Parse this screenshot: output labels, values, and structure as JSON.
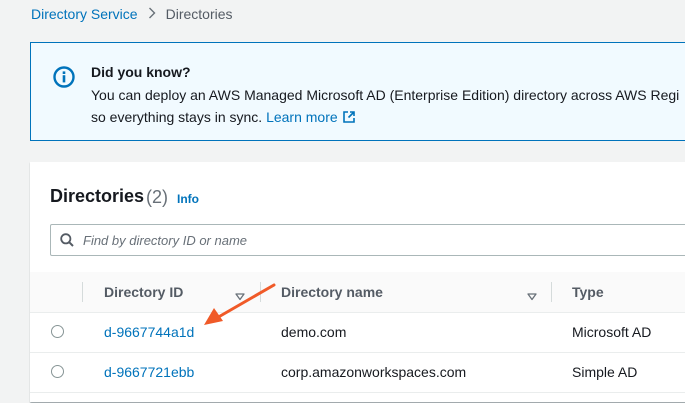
{
  "breadcrumb": {
    "service": "Directory Service",
    "separator": ">",
    "current": "Directories"
  },
  "alert": {
    "icon": "info-circle-icon",
    "title": "Did you know?",
    "line1": "You can deploy an AWS Managed Microsoft AD (Enterprise Edition) directory across AWS Regi",
    "line2": "so everything stays in sync.",
    "link": "Learn more",
    "link_icon": "external-link-icon"
  },
  "panel": {
    "title": "Directories",
    "count": "(2)",
    "info_label": "Info"
  },
  "search": {
    "placeholder": "Find by directory ID or name",
    "value": ""
  },
  "table": {
    "columns": [
      "Directory ID",
      "Directory name",
      "Type"
    ],
    "rows": [
      {
        "id": "d-9667744a1d",
        "name": "demo.com",
        "type": "Microsoft AD"
      },
      {
        "id": "d-9667721ebb",
        "name": "corp.amazonworkspaces.com",
        "type": "Simple AD"
      }
    ]
  },
  "colors": {
    "link": "#0073bb",
    "alert_bg": "#f1faff",
    "annotation_arrow": "#f05a28"
  }
}
